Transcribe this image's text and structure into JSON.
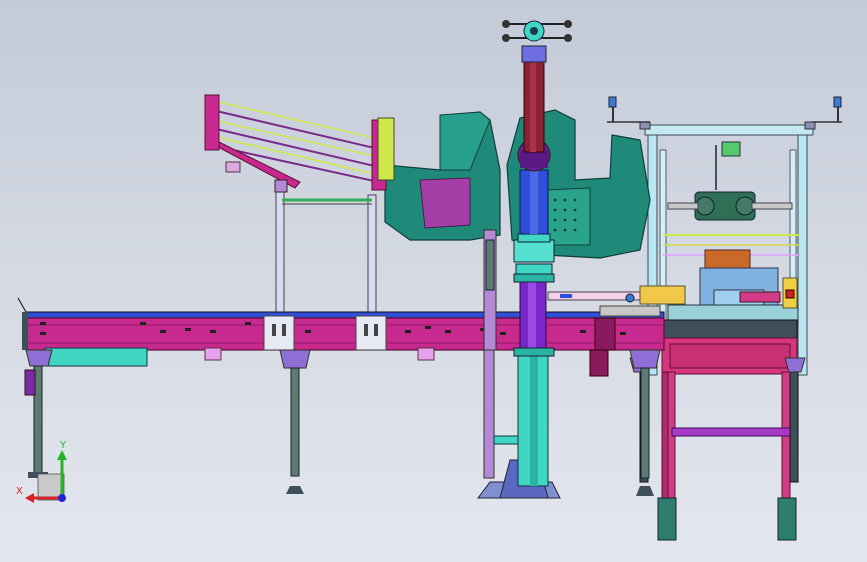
{
  "viewport": {
    "background_top": "#c4cbd8",
    "background_bottom": "#e4e7ee"
  },
  "colors": {
    "frame_magenta": "#c8298f",
    "frame_magenta_dark": "#8e1a63",
    "teal_guard": "#1f8a7a",
    "teal_dark": "#136052",
    "column_blue": "#2f4fd8",
    "column_cyan": "#3fd6c3",
    "column_purple": "#7a27c9",
    "column_maroon": "#8a2235",
    "leg_grey": "#5f7a73",
    "support_lilac": "#b48ad8",
    "station_frame": "#b9e6f0",
    "mint": "#3de2c0"
  },
  "axis_triad": {
    "x_label": "X",
    "y_label": "Y",
    "x_color": "#d42424",
    "y_color": "#27b327",
    "z_color": "#2424d4",
    "icon": "coordinate-triad-icon"
  }
}
